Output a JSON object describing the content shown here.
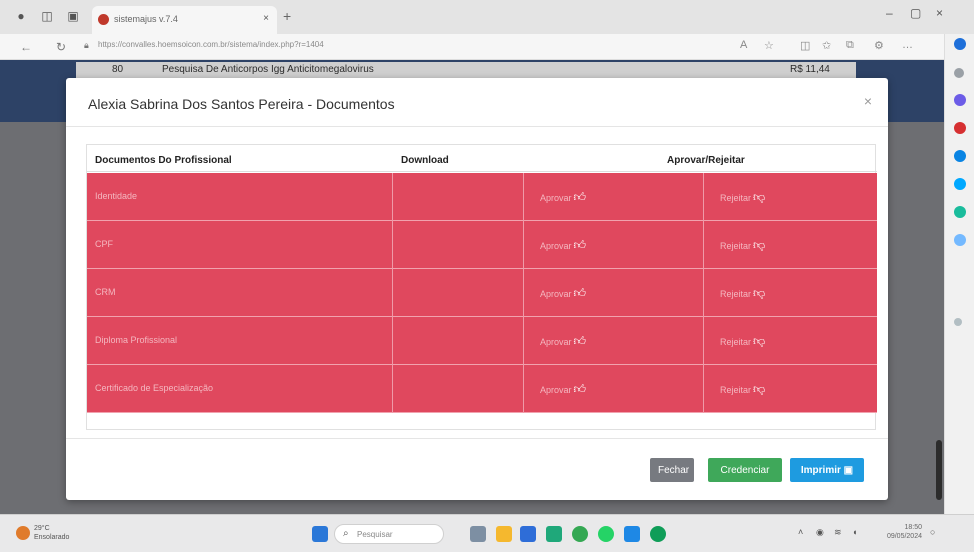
{
  "browser": {
    "tab_title": "sistemajus v.7.4",
    "new_tab": "+",
    "url": "https://convalles.hoemsoicon.com.br/sistema/index.php?r=1404",
    "win_min": "–",
    "win_max": "▢",
    "win_close": "×"
  },
  "background_page": {
    "row_code": "80",
    "row_desc": "Pesquisa De Anticorpos Igg Anticitomegalovirus",
    "row_price": "R$ 11,44"
  },
  "modal": {
    "title": "Alexia Sabrina Dos Santos Pereira - Documentos",
    "close_label": "×",
    "headers": {
      "documents": "Documentos Do Profissional",
      "download": "Download",
      "approve_reject": "Aprovar/Rejeitar"
    },
    "rows": [
      {
        "document": "Identidade",
        "approve": "Aprovar",
        "reject": "Rejeitar"
      },
      {
        "document": "CPF",
        "approve": "Aprovar",
        "reject": "Rejeitar"
      },
      {
        "document": "CRM",
        "approve": "Aprovar",
        "reject": "Rejeitar"
      },
      {
        "document": "Diploma Profissional",
        "approve": "Aprovar",
        "reject": "Rejeitar"
      },
      {
        "document": "Certificado de Especialização",
        "approve": "Aprovar",
        "reject": "Rejeitar"
      }
    ],
    "buttons": {
      "close": "Fechar",
      "credential": "Credenciar",
      "print": "Imprimir"
    }
  },
  "taskbar": {
    "weather_temp": "29°C",
    "weather_desc": "Ensolarado",
    "search_placeholder": "Pesquisar",
    "time": "18:50",
    "date": "09/05/2024"
  },
  "colors": {
    "row_reject": "#e0485e",
    "btn_close": "#777a80",
    "btn_credential": "#3fa85a",
    "btn_print": "#1e9be0"
  }
}
